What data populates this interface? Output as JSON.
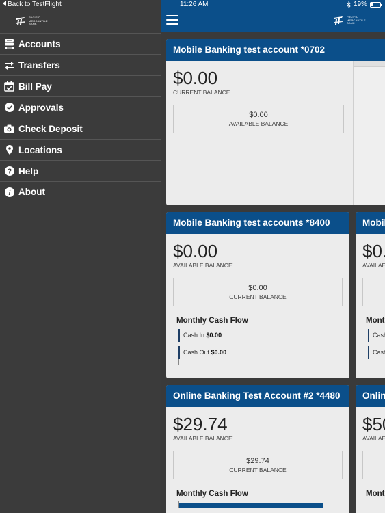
{
  "status": {
    "back_label": "Back to TestFlight",
    "time": "11:26 AM",
    "battery": "19%",
    "battery_level": 0.19
  },
  "brand": {
    "logo_lines": [
      "PACIFIC",
      "MERCANTILE",
      "BANK"
    ]
  },
  "colors": {
    "header_blue": "#0b4f8a",
    "sidebar_bg": "#3b3b3b",
    "card_bg": "#ececec"
  },
  "menu": {
    "items": [
      {
        "label": "Accounts",
        "icon": "accounts-icon"
      },
      {
        "label": "Transfers",
        "icon": "transfers-icon"
      },
      {
        "label": "Bill Pay",
        "icon": "calendar-check-icon"
      },
      {
        "label": "Approvals",
        "icon": "check-circle-icon"
      },
      {
        "label": "Check Deposit",
        "icon": "camera-icon"
      },
      {
        "label": "Locations",
        "icon": "map-pin-icon"
      },
      {
        "label": "Help",
        "icon": "help-icon"
      },
      {
        "label": "About",
        "icon": "info-icon"
      }
    ]
  },
  "accounts": [
    {
      "title": "Mobile Banking test account *0702",
      "main_amount": "$0.00",
      "main_label": "CURRENT BALANCE",
      "sub_amount": "$0.00",
      "sub_label": "AVAILABLE BALANCE"
    },
    {
      "title": "Mobile Banking test accounts *8400",
      "main_amount": "$0.00",
      "main_label": "AVAILABLE BALANCE",
      "sub_amount": "$0.00",
      "sub_label": "CURRENT BALANCE",
      "cash_flow_title": "Monthly Cash Flow",
      "cash_in_label": "Cash In",
      "cash_in_value": "$0.00",
      "cash_out_label": "Cash Out",
      "cash_out_value": "$0.00"
    },
    {
      "title": "Online Banking Test Account #2 *4480",
      "main_amount": "$29.74",
      "main_label": "AVAILABLE BALANCE",
      "sub_amount": "$29.74",
      "sub_label": "CURRENT BALANCE",
      "cash_flow_title": "Monthly Cash Flow"
    }
  ],
  "peek_cards": [
    {
      "title": "Mobil",
      "amount": "$0.",
      "label": "AVAILAE",
      "cash_flow": "Mont",
      "cash_in": "Cash",
      "cash_out": "Cash"
    },
    {
      "title": "Onlin",
      "amount": "$50",
      "label": "AVAILAE",
      "cash_flow": "Mont"
    }
  ]
}
